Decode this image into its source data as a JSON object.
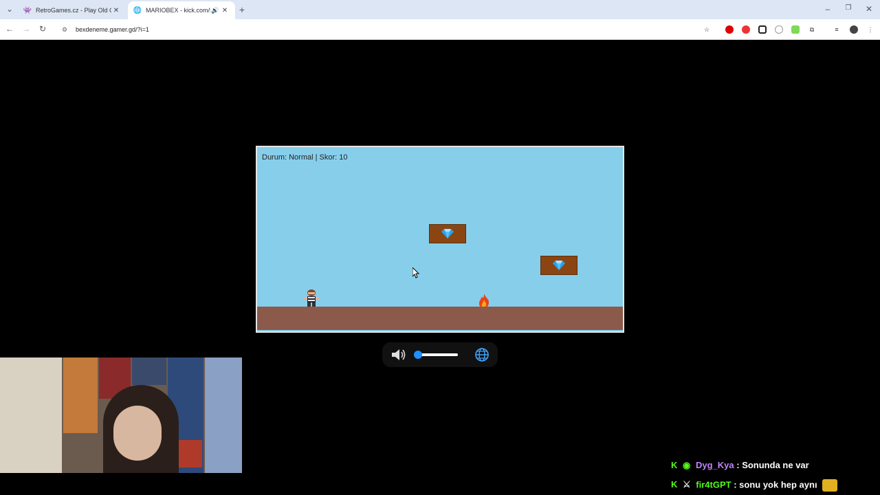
{
  "browser": {
    "tabs": [
      {
        "title": "RetroGames.cz - Play Old Game",
        "active": false,
        "icon": "invader-icon"
      },
      {
        "title": "MARIOBEX - kick.com/BAR",
        "active": true,
        "icon": "globe-icon"
      }
    ],
    "new_tab": "+",
    "url": "bexdeneme.gamer.gd/?i=1"
  },
  "game": {
    "hud": "Durum: Normal | Skor: 10",
    "colors": {
      "sky": "#87ceeb",
      "ground": "#8b5a4a",
      "block": "#8b4513",
      "gem": "#29a3e8"
    }
  },
  "controls": {
    "volume_icon": "speaker-icon",
    "volume_level": 0.1,
    "globe_icon": "globe-icon"
  },
  "chat": {
    "messages": [
      {
        "user": "Dyg_Kya",
        "text": ": Sonunda ne var"
      },
      {
        "user": "fir4tGPT",
        "text": ": sonu yok hep aynı"
      }
    ]
  }
}
